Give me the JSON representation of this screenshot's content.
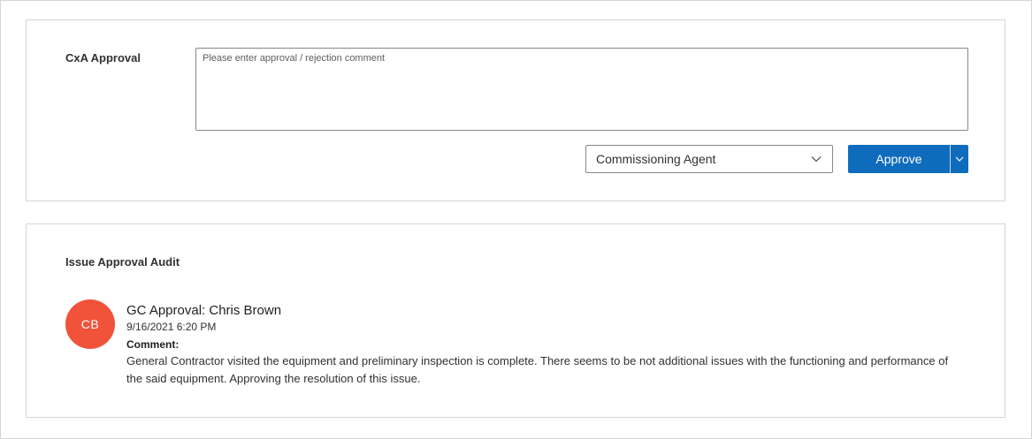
{
  "approval": {
    "label": "CxA Approval",
    "comment_placeholder": "Please enter approval / rejection comment",
    "comment_value": "",
    "role_dropdown": {
      "selected": "Commissioning Agent",
      "icon": "chevron-down-icon"
    },
    "approve_button": {
      "label": "Approve",
      "menu_icon": "chevron-down-icon"
    }
  },
  "audit": {
    "label": "Issue Approval Audit",
    "entries": [
      {
        "avatar_initials": "CB",
        "avatar_color": "#f0533a",
        "title": "GC Approval: Chris Brown",
        "timestamp": "9/16/2021 6:20 PM",
        "comment_label": "Comment:",
        "comment": "General Contractor visited the equipment and preliminary inspection is complete. There seems to be not additional issues with the functioning and performance of the said equipment. Approving the resolution of this issue."
      }
    ]
  },
  "colors": {
    "accent": "#0f6cbd",
    "border": "#d6d6d6"
  }
}
